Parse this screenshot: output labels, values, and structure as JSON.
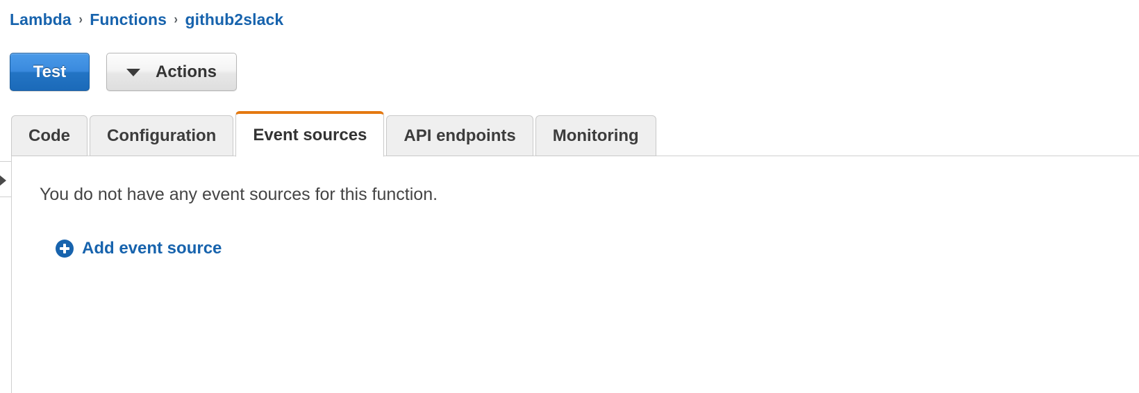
{
  "breadcrumb": {
    "items": [
      {
        "label": "Lambda"
      },
      {
        "label": "Functions"
      },
      {
        "label": "github2slack"
      }
    ],
    "separator": "›"
  },
  "toolbar": {
    "test_label": "Test",
    "actions_label": "Actions",
    "caret_icon": "caret-down-icon"
  },
  "tabs": [
    {
      "label": "Code",
      "active": false
    },
    {
      "label": "Configuration",
      "active": false
    },
    {
      "label": "Event sources",
      "active": true
    },
    {
      "label": "API endpoints",
      "active": false
    },
    {
      "label": "Monitoring",
      "active": false
    }
  ],
  "content": {
    "empty_message": "You do not have any event sources for this function.",
    "add_event_source_label": "Add event source",
    "add_icon": "plus-circle-icon"
  },
  "side_panel": {
    "toggle_icon": "expand-right-arrow-icon"
  },
  "colors": {
    "link_blue": "#1763ad",
    "active_tab_orange": "#e47911",
    "primary_button_blue": "#2374c4",
    "tab_gray": "#efefef",
    "border_gray": "#cfcfcf",
    "text_dark": "#444444"
  }
}
